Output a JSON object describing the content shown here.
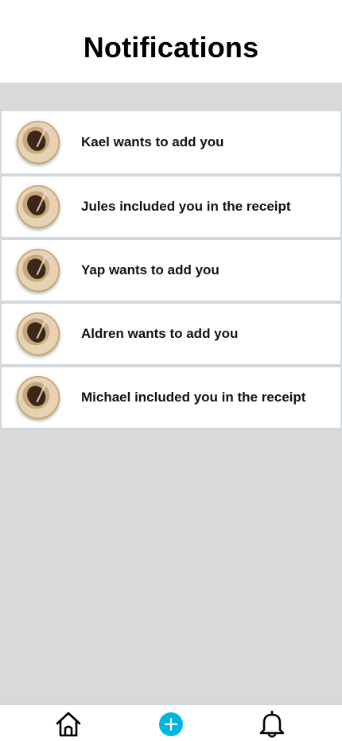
{
  "header": {
    "title": "Notifications"
  },
  "notifications": [
    {
      "text": "Kael wants to add you"
    },
    {
      "text": "Jules included you in the receipt"
    },
    {
      "text": "Yap wants to add you"
    },
    {
      "text": "Aldren wants to add you"
    },
    {
      "text": "Michael included you in the receipt"
    }
  ],
  "tabbar": {
    "items": [
      {
        "icon": "home-icon"
      },
      {
        "icon": "plus-icon"
      },
      {
        "icon": "bell-icon"
      }
    ]
  },
  "colors": {
    "background": "#d9d9d9",
    "accent": "#00b5e2",
    "divider": "#d3d8dc"
  }
}
